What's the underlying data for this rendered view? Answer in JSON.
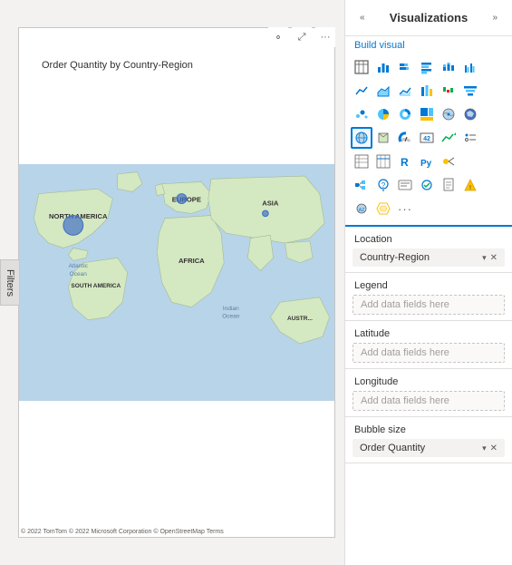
{
  "header": {
    "visualizations_title": "Visualizations",
    "collapse_left_label": "«",
    "collapse_right_label": "»",
    "build_visual_label": "Build visual"
  },
  "filters": {
    "label": "Filters"
  },
  "map": {
    "title": "Order Quantity by Country-Region",
    "attribution": "© 2022 TomTom © 2022 Microsoft Corporation © OpenStreetMap Terms"
  },
  "viz_icons": {
    "rows": [
      [
        "table-icon",
        "bar-chart-icon",
        "stacked-bar-icon",
        "clustered-bar-icon",
        "stacked-col-icon",
        "clustered-col-icon"
      ],
      [
        "line-icon",
        "area-icon",
        "line-stacked-icon",
        "ribbon-icon",
        "waterfall-icon",
        "funnel-icon"
      ],
      [
        "scatter-icon",
        "pie-icon",
        "donut-icon",
        "treemap-icon",
        "map-icon",
        "filled-map-icon"
      ],
      [
        "globe-icon",
        "shape-map-icon",
        "gauge-icon",
        "card-icon",
        "kpi-icon",
        "slicer-icon"
      ],
      [
        "matrix-icon",
        "table2-icon",
        "r-visual-icon",
        "py-visual-icon",
        "key-influencer-icon"
      ],
      [
        "decomp-tree-icon",
        "qa-icon",
        "smart-narrative-icon",
        "metric-icon",
        "paginated-icon",
        "custom-icon"
      ],
      [
        "azure-map-icon",
        "field-map-icon",
        "more-icon"
      ]
    ]
  },
  "fields": {
    "location": {
      "label": "Location",
      "value": "Country-Region",
      "has_chevron": true,
      "has_close": true
    },
    "legend": {
      "label": "Legend",
      "placeholder": "Add data fields here"
    },
    "latitude": {
      "label": "Latitude",
      "placeholder": "Add data fields here"
    },
    "longitude": {
      "label": "Longitude",
      "placeholder": "Add data fields here"
    },
    "bubble_size": {
      "label": "Bubble size",
      "value": "Order Quantity",
      "has_chevron": true,
      "has_close": true
    }
  }
}
